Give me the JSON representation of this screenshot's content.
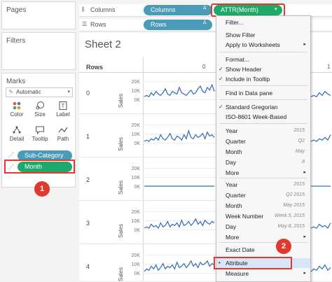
{
  "left": {
    "pages_title": "Pages",
    "filters_title": "Filters",
    "marks_title": "Marks",
    "mark_type": "Automatic",
    "buttons": [
      "Color",
      "Size",
      "Label",
      "Detail",
      "Tooltip",
      "Path"
    ],
    "fields": [
      "Sub-Category",
      "Month"
    ]
  },
  "shelves": {
    "columns_label": "Columns",
    "rows_label": "Rows",
    "columns_pills": [
      "Columns",
      "ATTR(Month)"
    ],
    "rows_pill": "Rows"
  },
  "sheet": {
    "title": "Sheet 2",
    "rows_header": "Rows",
    "col_zero": "0",
    "col_one": "1",
    "row_labels": [
      "0",
      "1",
      "2",
      "3",
      "4"
    ],
    "axis_title": "Sales",
    "ticks": [
      "20K",
      "10K",
      "0K"
    ]
  },
  "menu": {
    "items_top": [
      "Filter...",
      "Show Filter",
      "Apply to Worksheets",
      "Format...",
      "Show Header",
      "Include in Tooltip",
      "Find in Data pane",
      "Standard Gregorian",
      "ISO-8601 Week-Based"
    ],
    "discrete": [
      {
        "label": "Year",
        "hint": "2015"
      },
      {
        "label": "Quarter",
        "hint": "Q2"
      },
      {
        "label": "Month",
        "hint": "May"
      },
      {
        "label": "Day",
        "hint": "8"
      },
      {
        "label": "More",
        "hint": ""
      }
    ],
    "continuous": [
      {
        "label": "Year",
        "hint": "2015"
      },
      {
        "label": "Quarter",
        "hint": "Q2 2015"
      },
      {
        "label": "Month",
        "hint": "May 2015"
      },
      {
        "label": "Week Number",
        "hint": "Week 5, 2015"
      },
      {
        "label": "Day",
        "hint": "May 8, 2015"
      },
      {
        "label": "More",
        "hint": ""
      }
    ],
    "exact_date": "Exact Date",
    "attribute": "Attribute",
    "measure": "Measure"
  },
  "badges": [
    "1",
    "2"
  ],
  "colors": {
    "blue_pill": "#4a9ab8",
    "green_pill": "#1ea86a",
    "line": "#3b74b8",
    "highlight": "#d7e6f8",
    "callout": "#e0392e"
  }
}
